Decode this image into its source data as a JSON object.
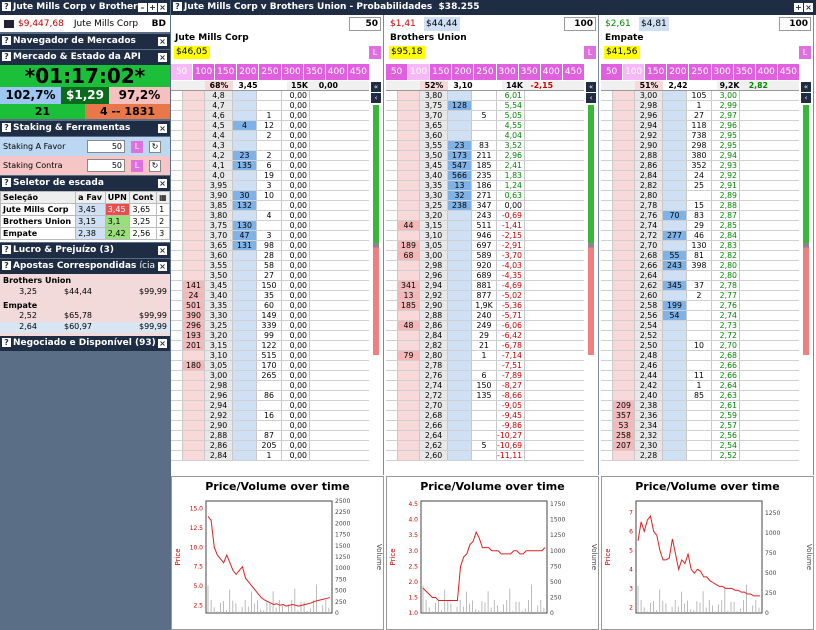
{
  "title_left": "Jute Mills Corp v Brothers",
  "title_main": "Jute Mills Corp v Brothers Union - Probabilidades",
  "total": "$38.255",
  "left": {
    "balance": "$9,447,68",
    "event": "Jute Mills Corp",
    "code": "BD",
    "nav": "Navegador de Mercados",
    "market_state": "Mercado & Estado da API",
    "timer": "*01:17:02*",
    "pct_back": "102,7%",
    "mid": "$1,29",
    "pct_lay": "97,2%",
    "count_a": "21",
    "count_b": "4 -- 1831",
    "staking": "Staking & Ferramentas",
    "stake_for_label": "Staking A Favor",
    "stake_for": "50",
    "stake_against_label": "Staking Contra",
    "stake_against": "50",
    "ladder_sel": "Seletor de escada",
    "sel_head": [
      "Seleção",
      "a Fav",
      "UPN",
      "Cont"
    ],
    "sel_rows": [
      [
        "Jute Mills Corp",
        "3,45",
        "3,45",
        "3,65",
        "1"
      ],
      [
        "Brothers Union",
        "3,15",
        "3,1",
        "3,25",
        "2"
      ],
      [
        "Empate",
        "2,38",
        "2,42",
        "2,56",
        "3"
      ]
    ],
    "pl": "Lucro & Prejuízo (3)",
    "matched": "Apostas Correspondidas",
    "matched_suffix": "ícia",
    "bu": "Brothers Union",
    "bu_a": "3,25",
    "bu_b": "$44,44",
    "bu_c": "$99,99",
    "em": "Empate",
    "em1": [
      "2,52",
      "$65,78",
      "$99,99"
    ],
    "em2": [
      "2,64",
      "$60,97",
      "$99,99"
    ],
    "traded": "Negociado e Disponível (93)"
  },
  "L": "L",
  "stake_buttons": [
    "50",
    "100",
    "150",
    "200",
    "250",
    "300",
    "350",
    "400",
    "450"
  ],
  "markets": [
    {
      "name": "Jute Mills Corp",
      "stake": "50",
      "price": "$46,05",
      "pl1": "",
      "pl2": "",
      "head": [
        "68%",
        "3,45",
        "",
        "15K",
        "0,00"
      ],
      "rows": [
        [
          "",
          "",
          "4,8",
          "",
          "",
          "0,00"
        ],
        [
          "",
          "",
          "4,7",
          "",
          "",
          "0,00"
        ],
        [
          "",
          "",
          "4,6",
          "",
          "1",
          "0,00"
        ],
        [
          "",
          "",
          "4,5",
          "4",
          "12",
          "0,00"
        ],
        [
          "",
          "",
          "4,4",
          "",
          "2",
          "0,00"
        ],
        [
          "",
          "",
          "4,3",
          "",
          "",
          "0,00"
        ],
        [
          "",
          "",
          "4,2",
          "23",
          "2",
          "0,00"
        ],
        [
          "",
          "",
          "4,1",
          "135",
          "6",
          "0,00"
        ],
        [
          "",
          "",
          "4,0",
          "",
          "19",
          "0,00"
        ],
        [
          "",
          "",
          "3,95",
          "",
          "3",
          "0,00"
        ],
        [
          "",
          "",
          "3,90",
          "30",
          "10",
          "0,00"
        ],
        [
          "",
          "",
          "3,85",
          "132",
          "",
          "0,00"
        ],
        [
          "",
          "",
          "3,80",
          "",
          "4",
          "0,00"
        ],
        [
          "",
          "",
          "3,75",
          "130",
          "",
          "0,00"
        ],
        [
          "",
          "",
          "3,70",
          "47",
          "3",
          "0,00"
        ],
        [
          "",
          "",
          "3,65",
          "131",
          "98",
          "0,00"
        ],
        [
          "",
          "",
          "3,60",
          "",
          "28",
          "0,00"
        ],
        [
          "",
          "",
          "3,55",
          "",
          "58",
          "0,00"
        ],
        [
          "",
          "",
          "3,50",
          "",
          "27",
          "0,00"
        ],
        [
          "",
          "141",
          "3,45",
          "",
          "150",
          "0,00"
        ],
        [
          "",
          "24",
          "3,40",
          "",
          "35",
          "0,00"
        ],
        [
          "",
          "501",
          "3,35",
          "",
          "60",
          "0,00"
        ],
        [
          "",
          "390",
          "3,30",
          "",
          "149",
          "0,00"
        ],
        [
          "",
          "296",
          "3,25",
          "",
          "339",
          "0,00"
        ],
        [
          "",
          "193",
          "3,20",
          "",
          "99",
          "0,00"
        ],
        [
          "",
          "201",
          "3,15",
          "",
          "122",
          "0,00"
        ],
        [
          "",
          "",
          "3,10",
          "",
          "515",
          "0,00"
        ],
        [
          "",
          "180",
          "3,05",
          "",
          "170",
          "0,00"
        ],
        [
          "",
          "",
          "3,00",
          "",
          "265",
          "0,00"
        ],
        [
          "",
          "",
          "2,98",
          "",
          "",
          "0,00"
        ],
        [
          "",
          "",
          "2,96",
          "",
          "86",
          "0,00"
        ],
        [
          "",
          "",
          "2,94",
          "",
          "",
          "0,00"
        ],
        [
          "",
          "",
          "2,92",
          "",
          "16",
          "0,00"
        ],
        [
          "",
          "",
          "2,90",
          "",
          "",
          "0,00"
        ],
        [
          "",
          "",
          "2,88",
          "",
          "87",
          "0,00"
        ],
        [
          "",
          "",
          "2,86",
          "",
          "205",
          "0,00"
        ],
        [
          "",
          "",
          "2,84",
          "",
          "1",
          "0,00"
        ]
      ]
    },
    {
      "name": "Brothers Union",
      "stake": "100",
      "price": "$95,18",
      "pl1": "$1,41",
      "pl2": "$44,44",
      "head": [
        "52%",
        "3,10",
        "",
        "14K",
        "-2,15"
      ],
      "rows": [
        [
          "",
          "",
          "3,80",
          "",
          "",
          "6,01"
        ],
        [
          "",
          "",
          "3,75",
          "128",
          "",
          "5,54"
        ],
        [
          "",
          "",
          "3,70",
          "",
          "5",
          "5,05"
        ],
        [
          "",
          "",
          "3,65",
          "",
          "",
          "4,55"
        ],
        [
          "",
          "",
          "3,60",
          "",
          "",
          "4,04"
        ],
        [
          "",
          "",
          "3,55",
          "23",
          "83",
          "3,52"
        ],
        [
          "",
          "",
          "3,50",
          "173",
          "211",
          "2,96"
        ],
        [
          "",
          "",
          "3,45",
          "547",
          "185",
          "2,41"
        ],
        [
          "",
          "",
          "3,40",
          "566",
          "235",
          "1,83"
        ],
        [
          "",
          "",
          "3,35",
          "13",
          "186",
          "1,24"
        ],
        [
          "",
          "",
          "3,30",
          "32",
          "271",
          "0,63"
        ],
        [
          "",
          "",
          "3,25",
          "238",
          "347",
          "0,00"
        ],
        [
          "",
          "",
          "3,20",
          "",
          "243",
          "-0,69"
        ],
        [
          "",
          "44",
          "3,15",
          "",
          "511",
          "-1,41"
        ],
        [
          "",
          "",
          "3,10",
          "",
          "946",
          "-2,15"
        ],
        [
          "",
          "189",
          "3,05",
          "",
          "697",
          "-2,91"
        ],
        [
          "",
          "68",
          "3,00",
          "",
          "589",
          "-3,70"
        ],
        [
          "",
          "",
          "2,98",
          "",
          "920",
          "-4,03"
        ],
        [
          "",
          "",
          "2,96",
          "",
          "689",
          "-4,35"
        ],
        [
          "",
          "341",
          "2,94",
          "",
          "881",
          "-4,69"
        ],
        [
          "",
          "13",
          "2,92",
          "",
          "877",
          "-5,02"
        ],
        [
          "",
          "185",
          "2,90",
          "",
          "1,9K",
          "-5,36"
        ],
        [
          "",
          "",
          "2,88",
          "",
          "240",
          "-5,71"
        ],
        [
          "",
          "48",
          "2,86",
          "",
          "249",
          "-6,06"
        ],
        [
          "",
          "",
          "2,84",
          "",
          "29",
          "-6,42"
        ],
        [
          "",
          "",
          "2,82",
          "",
          "21",
          "-6,78"
        ],
        [
          "",
          "79",
          "2,80",
          "",
          "1",
          "-7,14"
        ],
        [
          "",
          "",
          "2,78",
          "",
          "",
          "-7,51"
        ],
        [
          "",
          "",
          "2,76",
          "",
          "6",
          "-7,89"
        ],
        [
          "",
          "",
          "2,74",
          "",
          "150",
          "-8,27"
        ],
        [
          "",
          "",
          "2,72",
          "",
          "135",
          "-8,66"
        ],
        [
          "",
          "",
          "2,70",
          "",
          "",
          "-9,05"
        ],
        [
          "",
          "",
          "2,68",
          "",
          "",
          "-9,45"
        ],
        [
          "",
          "",
          "2,66",
          "",
          "",
          "-9,86"
        ],
        [
          "",
          "",
          "2,64",
          "",
          "",
          "-10,27"
        ],
        [
          "",
          "",
          "2,62",
          "",
          "5",
          "-10,69"
        ],
        [
          "",
          "",
          "2,60",
          "",
          "",
          "-11,11"
        ]
      ]
    },
    {
      "name": "Empate",
      "stake": "100",
      "price": "$41,56",
      "pl1": "$2,61",
      "pl2": "$4,81",
      "head": [
        "51%",
        "2,42",
        "",
        "9,2K",
        "2,82"
      ],
      "rows": [
        [
          "",
          "",
          "3,00",
          "",
          "105",
          "3,00"
        ],
        [
          "",
          "",
          "2,98",
          "",
          "1",
          "2,99"
        ],
        [
          "",
          "",
          "2,96",
          "",
          "27",
          "2,97"
        ],
        [
          "",
          "",
          "2,94",
          "",
          "118",
          "2,96"
        ],
        [
          "",
          "",
          "2,92",
          "",
          "738",
          "2,95"
        ],
        [
          "",
          "",
          "2,90",
          "",
          "298",
          "2,95"
        ],
        [
          "",
          "",
          "2,88",
          "",
          "380",
          "2,94"
        ],
        [
          "",
          "",
          "2,86",
          "",
          "352",
          "2,93"
        ],
        [
          "",
          "",
          "2,84",
          "",
          "24",
          "2,92"
        ],
        [
          "",
          "",
          "2,82",
          "",
          "25",
          "2,91"
        ],
        [
          "",
          "",
          "2,80",
          "",
          "",
          "2,89"
        ],
        [
          "",
          "",
          "2,78",
          "",
          "15",
          "2,88"
        ],
        [
          "",
          "",
          "2,76",
          "70",
          "83",
          "2,87"
        ],
        [
          "",
          "",
          "2,74",
          "",
          "29",
          "2,85"
        ],
        [
          "",
          "",
          "2,72",
          "277",
          "46",
          "2,84"
        ],
        [
          "",
          "",
          "2,70",
          "",
          "130",
          "2,83"
        ],
        [
          "",
          "",
          "2,68",
          "55",
          "81",
          "2,82"
        ],
        [
          "",
          "",
          "2,66",
          "243",
          "398",
          "2,80"
        ],
        [
          "",
          "",
          "2,64",
          "",
          "",
          "2,80"
        ],
        [
          "",
          "",
          "2,62",
          "345",
          "37",
          "2,78"
        ],
        [
          "",
          "",
          "2,60",
          "",
          "2",
          "2,77"
        ],
        [
          "",
          "",
          "2,58",
          "199",
          "",
          "2,76"
        ],
        [
          "",
          "",
          "2,56",
          "54",
          "",
          "2,74"
        ],
        [
          "",
          "",
          "2,54",
          "",
          "",
          "2,73"
        ],
        [
          "",
          "",
          "2,52",
          "",
          "",
          "2,72"
        ],
        [
          "",
          "",
          "2,50",
          "",
          "10",
          "2,70"
        ],
        [
          "",
          "",
          "2,48",
          "",
          "",
          "2,68"
        ],
        [
          "",
          "",
          "2,46",
          "",
          "",
          "2,66"
        ],
        [
          "",
          "",
          "2,44",
          "",
          "11",
          "2,66"
        ],
        [
          "",
          "",
          "2,42",
          "",
          "1",
          "2,64"
        ],
        [
          "",
          "",
          "2,40",
          "",
          "85",
          "2,63"
        ],
        [
          "",
          "209",
          "2,38",
          "",
          "",
          "2,61"
        ],
        [
          "",
          "357",
          "2,36",
          "",
          "",
          "2,59"
        ],
        [
          "",
          "53",
          "2,34",
          "",
          "",
          "2,57"
        ],
        [
          "",
          "258",
          "2,32",
          "",
          "",
          "2,56"
        ],
        [
          "",
          "207",
          "2,30",
          "",
          "",
          "2,54"
        ],
        [
          "",
          "",
          "2,28",
          "",
          "",
          "2,52"
        ]
      ]
    }
  ],
  "chart_title": "Price/Volume over time",
  "chart_data": [
    {
      "type": "line",
      "title": "Price/Volume over time",
      "ylabel": "Price",
      "y2label": "Volume",
      "yticks": [
        "2.5",
        "5.0",
        "7.5",
        "10.0",
        "12.5",
        "15.0"
      ],
      "y2ticks": [
        "0",
        "250",
        "500",
        "750",
        "1000",
        "1250",
        "1500",
        "1750",
        "2000",
        "2250",
        "2500"
      ],
      "ylim": [
        1.5,
        16
      ],
      "y2lim": [
        0,
        2500
      ],
      "price": [
        14,
        13.5,
        10,
        9,
        8.5,
        8,
        9,
        8,
        7,
        6.5,
        7,
        7.5,
        6,
        5.5,
        5,
        4.5,
        4,
        3.5,
        3.2,
        3,
        2.8,
        2.6,
        2.7,
        2.5,
        2.6,
        2.4,
        2.5,
        2.6,
        2.5,
        2.4,
        2.5,
        2.6,
        2.7,
        2.8,
        3,
        3.1,
        3.2,
        3.3,
        3.4,
        3.5
      ]
    },
    {
      "type": "line",
      "title": "Price/Volume over time",
      "ylabel": "Price",
      "y2label": "Volume",
      "yticks": [
        "1.0",
        "1.5",
        "2.0",
        "2.5",
        "3.0",
        "3.5",
        "4.0",
        "4.5"
      ],
      "y2ticks": [
        "0",
        "250",
        "500",
        "750",
        "1000",
        "1250",
        "1500",
        "1750"
      ],
      "ylim": [
        1,
        4.6
      ],
      "y2lim": [
        0,
        1800
      ],
      "price": [
        1.8,
        1.7,
        1.6,
        1.5,
        1.5,
        1.4,
        1.4,
        1.4,
        1.4,
        1.4,
        1.4,
        1.4,
        2.5,
        2.8,
        2.9,
        3.2,
        3.3,
        3.6,
        3.4,
        3.1,
        3.1,
        3.1,
        3.0,
        3.0,
        3.0,
        2.9,
        2.9,
        2.9,
        2.9,
        3.0,
        3.0,
        2.9,
        2.9,
        3.0,
        3.0,
        3.0,
        3.0,
        3.0,
        3.0,
        3.1
      ]
    },
    {
      "type": "line",
      "title": "Price/Volume over time",
      "ylabel": "Price",
      "y2label": "Volume",
      "yticks": [
        "2",
        "3",
        "4",
        "5",
        "6",
        "7"
      ],
      "y2ticks": [
        "0",
        "250",
        "500",
        "750",
        "1000",
        "1250"
      ],
      "ylim": [
        1.7,
        7.6
      ],
      "y2lim": [
        0,
        1400
      ],
      "price": [
        5.5,
        6.5,
        6,
        6.6,
        6.8,
        6,
        5.8,
        5,
        4.5,
        4.5,
        4.6,
        5.6,
        4.8,
        4,
        4.5,
        4.3,
        4.8,
        4,
        3.8,
        4,
        3.9,
        3.6,
        3.6,
        3.4,
        3.3,
        3.2,
        3.1,
        3.1,
        3.0,
        3.0,
        3.0,
        2.9,
        2.9,
        2.8,
        2.8,
        2.7,
        2.7,
        2.6,
        2.6,
        2.6
      ]
    }
  ]
}
